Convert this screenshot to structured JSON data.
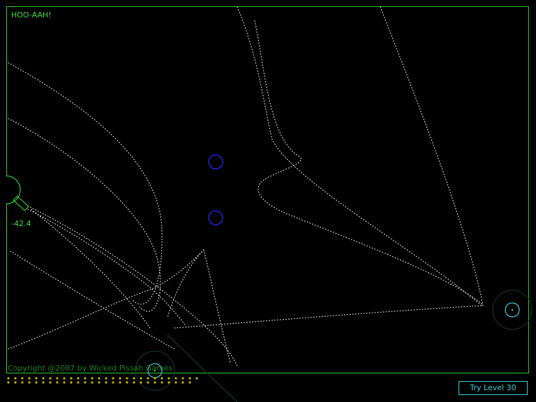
{
  "status_message": "HOO-AAH!",
  "cannon": {
    "angle_readout": "-42.4"
  },
  "copyright": "Copyright @2007 by Wicked Pissah Games",
  "try_level_button": "Try Level 30",
  "ammo": {
    "count": 55
  },
  "colors": {
    "border": "#2ecc2e",
    "hud_text": "#3cdc3c",
    "trail": "#d8d8d8",
    "obstacle": "#1e24d8",
    "target": "#39d0d8",
    "ammo": "#c8b400"
  },
  "icons": {
    "cannon": "cannon-icon",
    "obstacles": [
      "gravity-well-icon",
      "gravity-well-icon"
    ],
    "targets": [
      "target-ring-icon",
      "target-ring-icon"
    ]
  }
}
